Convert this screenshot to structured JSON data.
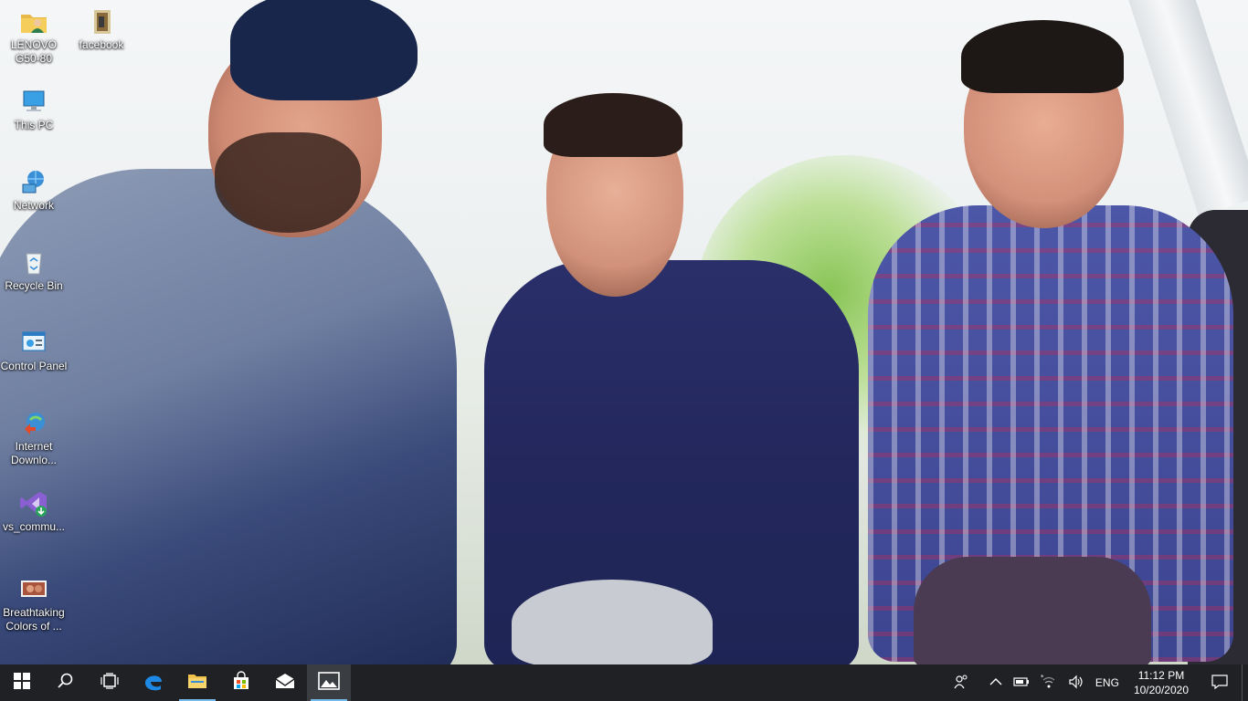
{
  "desktop_icons": [
    {
      "id": "lenovo",
      "label": "LENOVO G50-80",
      "icon": "user-folder-icon"
    },
    {
      "id": "facebook",
      "label": "facebook",
      "icon": "folder-icon"
    },
    {
      "id": "this_pc",
      "label": "This PC",
      "icon": "computer-icon"
    },
    {
      "id": "network",
      "label": "Network",
      "icon": "network-icon"
    },
    {
      "id": "recycle_bin",
      "label": "Recycle Bin",
      "icon": "recycle-bin-icon"
    },
    {
      "id": "control_panel",
      "label": "Control Panel",
      "icon": "control-panel-icon"
    },
    {
      "id": "idm",
      "label": "Internet Downlo...",
      "icon": "download-manager-icon"
    },
    {
      "id": "vs",
      "label": "vs_commu...",
      "icon": "visual-studio-installer-icon"
    },
    {
      "id": "breathtaking",
      "label": "Breathtaking Colors of ...",
      "icon": "image-file-icon"
    }
  ],
  "taskbar": {
    "apps": [
      {
        "name": "start",
        "icon": "windows-start-icon"
      },
      {
        "name": "search",
        "icon": "search-icon"
      },
      {
        "name": "task-view",
        "icon": "task-view-icon"
      },
      {
        "name": "edge",
        "icon": "edge-icon"
      },
      {
        "name": "file-explorer",
        "icon": "file-explorer-icon",
        "active": true
      },
      {
        "name": "store",
        "icon": "microsoft-store-icon"
      },
      {
        "name": "mail",
        "icon": "mail-icon"
      },
      {
        "name": "photos",
        "icon": "photos-icon",
        "active": true,
        "focused": true
      }
    ],
    "tray": {
      "language": "ENG",
      "time": "11:12 PM",
      "date": "10/20/2020"
    }
  },
  "colors": {
    "taskbar_bg": "#1f2125",
    "active_indicator": "#76b9ed"
  }
}
